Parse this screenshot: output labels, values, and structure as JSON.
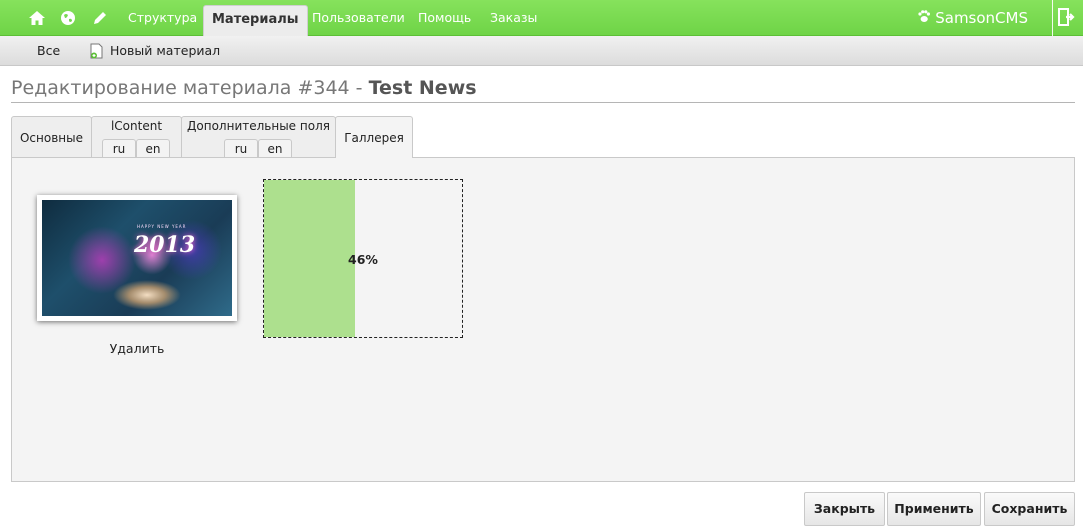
{
  "topbar": {
    "icons": [
      "home-icon",
      "globe-icon",
      "pencil-icon",
      "exit-icon"
    ],
    "nav": [
      "Структура",
      "Материалы",
      "Пользователи",
      "Помощь",
      "Заказы"
    ],
    "active": "Материалы",
    "brand": "SamsonCMS",
    "accent_color": "#76d94f"
  },
  "subbar": {
    "all_label": "Все",
    "new_material_label": "Новый материал"
  },
  "page": {
    "title_prefix": "Редактирование материала #344 - ",
    "title_name": "Test News"
  },
  "tabs": {
    "main": "Основные",
    "icontent": "lContent",
    "extra": "Дополнительные поля",
    "gallery": "Галлерея",
    "active": "Галлерея",
    "lang_ru": "ru",
    "lang_en": "en"
  },
  "gallery": {
    "image_text": "2013",
    "image_caption_small": "HAPPY NEW YEAR",
    "delete_label": "Удалить",
    "upload_progress": 0.46,
    "upload_progress_label": "46%",
    "progress_color": "#ade08e"
  },
  "actions": {
    "close": "Закрыть",
    "apply": "Применить",
    "save": "Сохранить"
  }
}
